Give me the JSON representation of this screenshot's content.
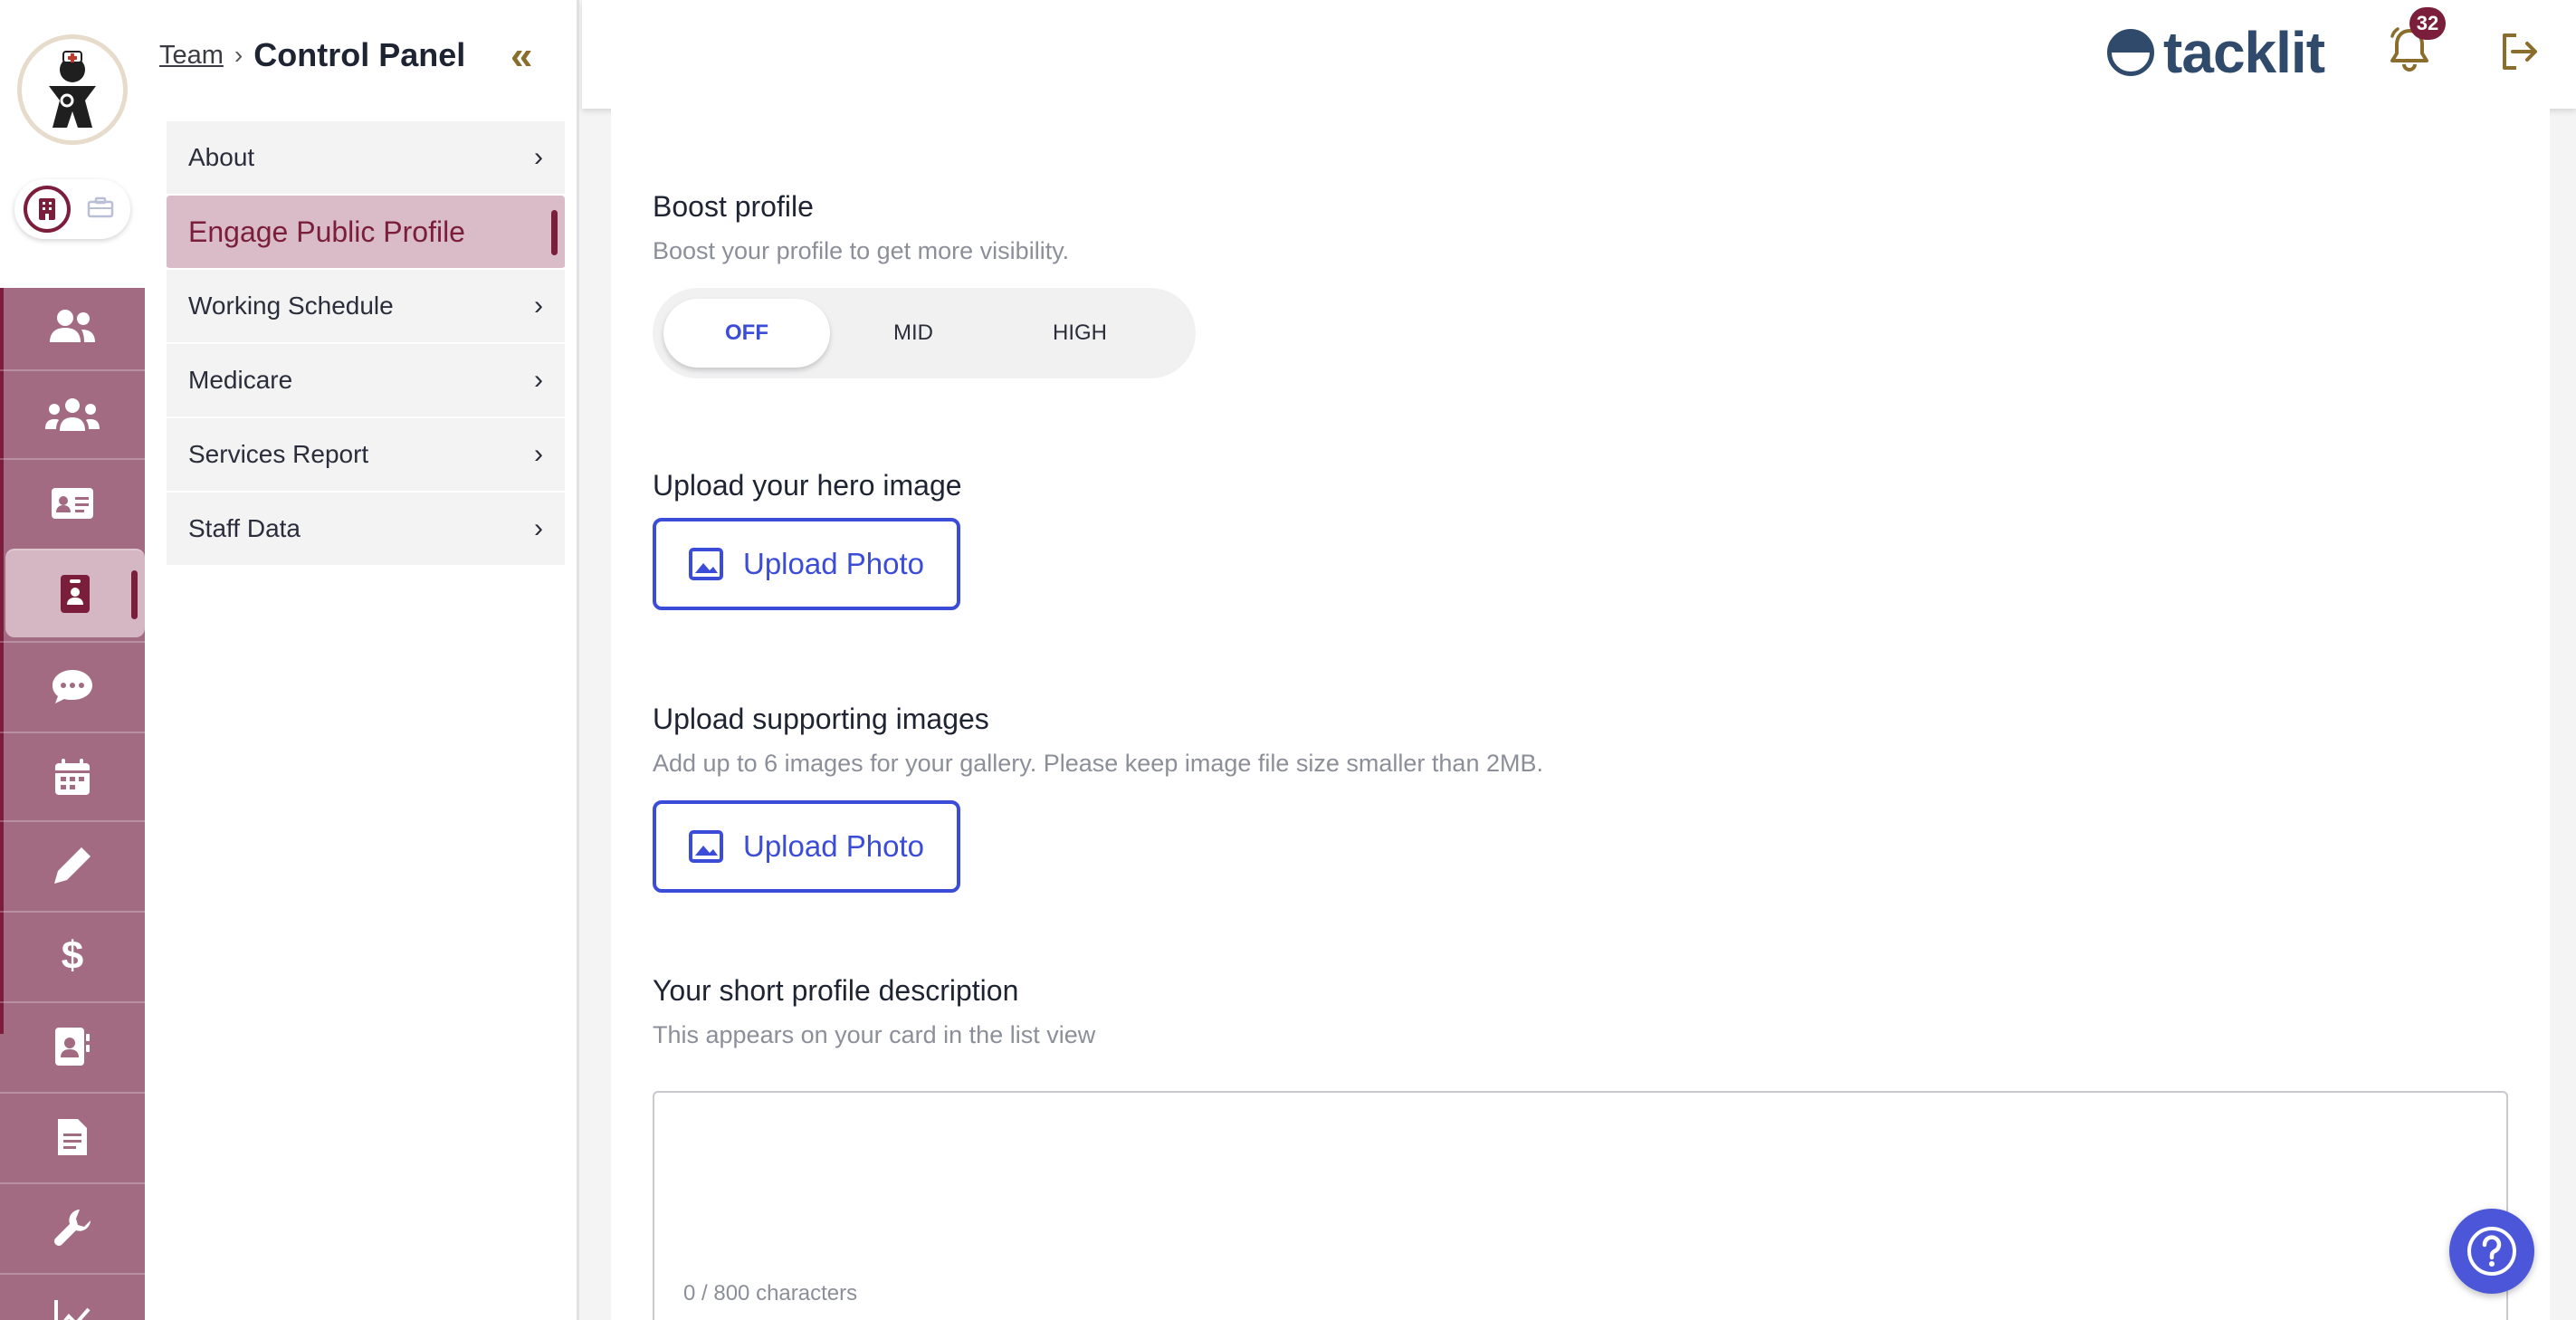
{
  "breadcrumb": {
    "team": "Team",
    "title": "Control Panel"
  },
  "menu": {
    "items": [
      {
        "label": "About"
      },
      {
        "label": "Engage Public Profile"
      },
      {
        "label": "Working Schedule"
      },
      {
        "label": "Medicare"
      },
      {
        "label": "Services Report"
      },
      {
        "label": "Staff Data"
      }
    ]
  },
  "header": {
    "brand": "tacklit",
    "notification_count": "32"
  },
  "boost": {
    "title": "Boost profile",
    "subtitle": "Boost your profile to get more visibility.",
    "options": [
      "OFF",
      "MID",
      "HIGH"
    ],
    "selected": "OFF"
  },
  "hero": {
    "title": "Upload your hero image",
    "button": "Upload Photo"
  },
  "supporting": {
    "title": "Upload supporting images",
    "subtitle": "Add up to 6 images for your gallery. Please keep image file size smaller than 2MB.",
    "button": "Upload Photo"
  },
  "description": {
    "title": "Your short profile description",
    "subtitle": "This appears on your card in the list view",
    "counter": "0 / 800 characters"
  },
  "colors": {
    "brand": "#2f4a6b",
    "accent": "#3b4cd8",
    "primary": "#7b1e3b",
    "rail": "#a26b82"
  }
}
